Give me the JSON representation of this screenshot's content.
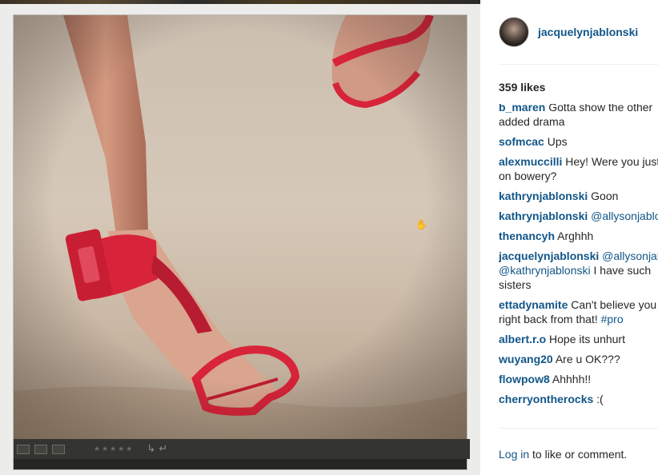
{
  "post": {
    "username": "jacquelynjablonski",
    "likes": "359 likes",
    "comments": [
      {
        "user": "b_maren",
        "segments": [
          {
            "text": " Gotta show the other "
          }
        ],
        "wrap": "added drama"
      },
      {
        "user": "sofmcac",
        "segments": [
          {
            "text": " Ups"
          }
        ]
      },
      {
        "user": "alexmuccilli",
        "segments": [
          {
            "text": " Hey! Were you just"
          }
        ],
        "wrap": "on bowery?"
      },
      {
        "user": "kathrynjablonski",
        "segments": [
          {
            "text": " Goon"
          }
        ]
      },
      {
        "user": "kathrynjablonski",
        "segments": [
          {
            "text": " "
          },
          {
            "text": "@allysonjablonski",
            "tag": true
          }
        ]
      },
      {
        "user": "thenancyh",
        "segments": [
          {
            "text": " Arghhh"
          }
        ]
      },
      {
        "user": "jacquelynjablonski",
        "segments": [
          {
            "text": " "
          },
          {
            "text": "@allysonjablonski",
            "tag": true
          }
        ],
        "wrap_segments": [
          {
            "text": "@kathrynjablonski",
            "tag": true
          },
          {
            "text": " I have such"
          }
        ],
        "wrap2": "sisters"
      },
      {
        "user": "ettadynamite",
        "segments": [
          {
            "text": " Can't believe you"
          }
        ],
        "wrap_segments": [
          {
            "text": "right back from that! "
          },
          {
            "text": "#pro",
            "tag": true
          }
        ]
      },
      {
        "user": "albert.r.o",
        "segments": [
          {
            "text": " Hope its unhurt"
          }
        ]
      },
      {
        "user": "wuyang20",
        "segments": [
          {
            "text": " Are u OK???"
          }
        ]
      },
      {
        "user": "flowpow8",
        "segments": [
          {
            "text": " Ahhhh!!"
          }
        ]
      },
      {
        "user": "cherryontherocks",
        "segments": [
          {
            "text": " :("
          }
        ]
      }
    ],
    "login_link": "Log in",
    "login_rest": " to like or comment."
  },
  "photo": {
    "alt_icon_names": [
      "hand-cursor-icon"
    ],
    "toolbar_stars": "★★★★★",
    "toolbar_arrows": "↳ ↵"
  },
  "colors": {
    "link_blue": "#125688",
    "text": "#262626",
    "sandal_red": "#d8243a"
  }
}
